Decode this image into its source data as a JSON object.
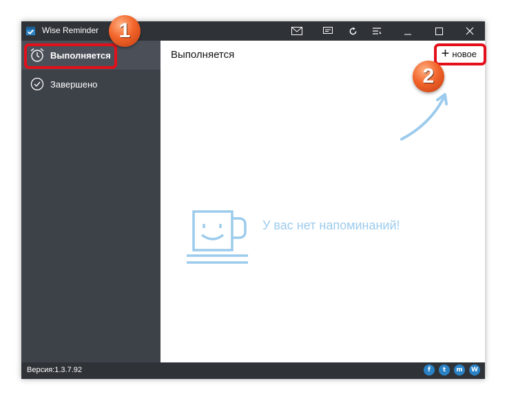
{
  "window": {
    "title": "Wise Reminder"
  },
  "titlebar_icons": [
    "mail-icon",
    "message-icon",
    "refresh-icon",
    "menu-icon",
    "minimize-icon",
    "maximize-icon",
    "close-icon"
  ],
  "sidebar": {
    "items": [
      {
        "label": "Выполняется",
        "icon": "alarm-clock-icon",
        "active": true
      },
      {
        "label": "Завершено",
        "icon": "check-circle-icon",
        "active": false
      }
    ]
  },
  "main": {
    "title": "Выполняется",
    "new_button": "новое",
    "empty_message": "У вас нет напоминаний!"
  },
  "footer": {
    "version": "Версия:1.3.7.92",
    "social": [
      "f",
      "t",
      "m",
      "W"
    ]
  },
  "annotations": {
    "badge1": "1",
    "badge2": "2"
  },
  "colors": {
    "accent_red": "#e3101b",
    "empty_state": "#9ccbec",
    "sidebar_bg": "#3d4249"
  }
}
